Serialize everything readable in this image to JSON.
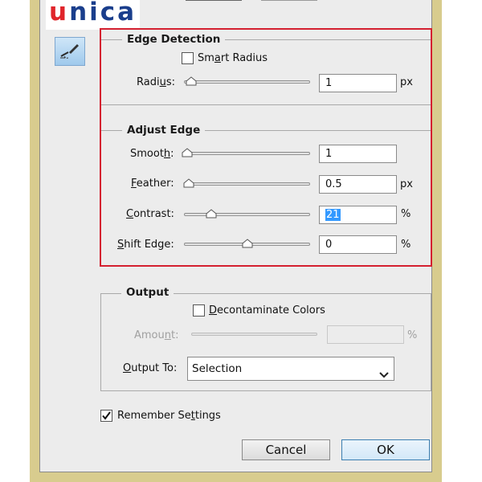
{
  "watermark": {
    "text_u": "u",
    "text_rest": "nica"
  },
  "tool_icon": "refine-radius-brush-icon",
  "edge_detection": {
    "title": "Edge Detection",
    "smart_radius": {
      "label_pre": "Sm",
      "label_u": "a",
      "label_post": "rt Radius",
      "checked": false
    },
    "radius": {
      "label_pre": "Radi",
      "label_u": "u",
      "label_post": "s:",
      "value": "1",
      "unit": "px",
      "level": 0.0
    }
  },
  "adjust_edge": {
    "title": "Adjust Edge",
    "smooth": {
      "label_pre": "Smoot",
      "label_u": "h",
      "label_post": ":",
      "value": "1",
      "level": 0.0
    },
    "feather": {
      "label_pre": "",
      "label_u": "F",
      "label_post": "eather:",
      "value": "0.5",
      "unit": "px",
      "level": 0.0
    },
    "contrast": {
      "label_pre": "",
      "label_u": "C",
      "label_post": "ontrast:",
      "value": "21",
      "unit": "%",
      "level": 0.21
    },
    "shift_edge": {
      "label_pre": "",
      "label_u": "S",
      "label_post": "hift Edge:",
      "value": "0",
      "unit": "%",
      "level": 0.5
    }
  },
  "output": {
    "title": "Output",
    "decontaminate": {
      "label_pre": "",
      "label_u": "D",
      "label_post": "econtaminate Colors",
      "checked": false
    },
    "amount": {
      "label_pre": "Amou",
      "label_u": "n",
      "label_post": "t:",
      "unit": "%"
    },
    "output_to": {
      "label_pre": "",
      "label_u": "O",
      "label_post": "utput To:",
      "value": "Selection"
    }
  },
  "remember": {
    "label_pre": "Remember Se",
    "label_u": "t",
    "label_post": "tings",
    "checked": true
  },
  "buttons": {
    "cancel": "Cancel",
    "ok": "OK"
  }
}
